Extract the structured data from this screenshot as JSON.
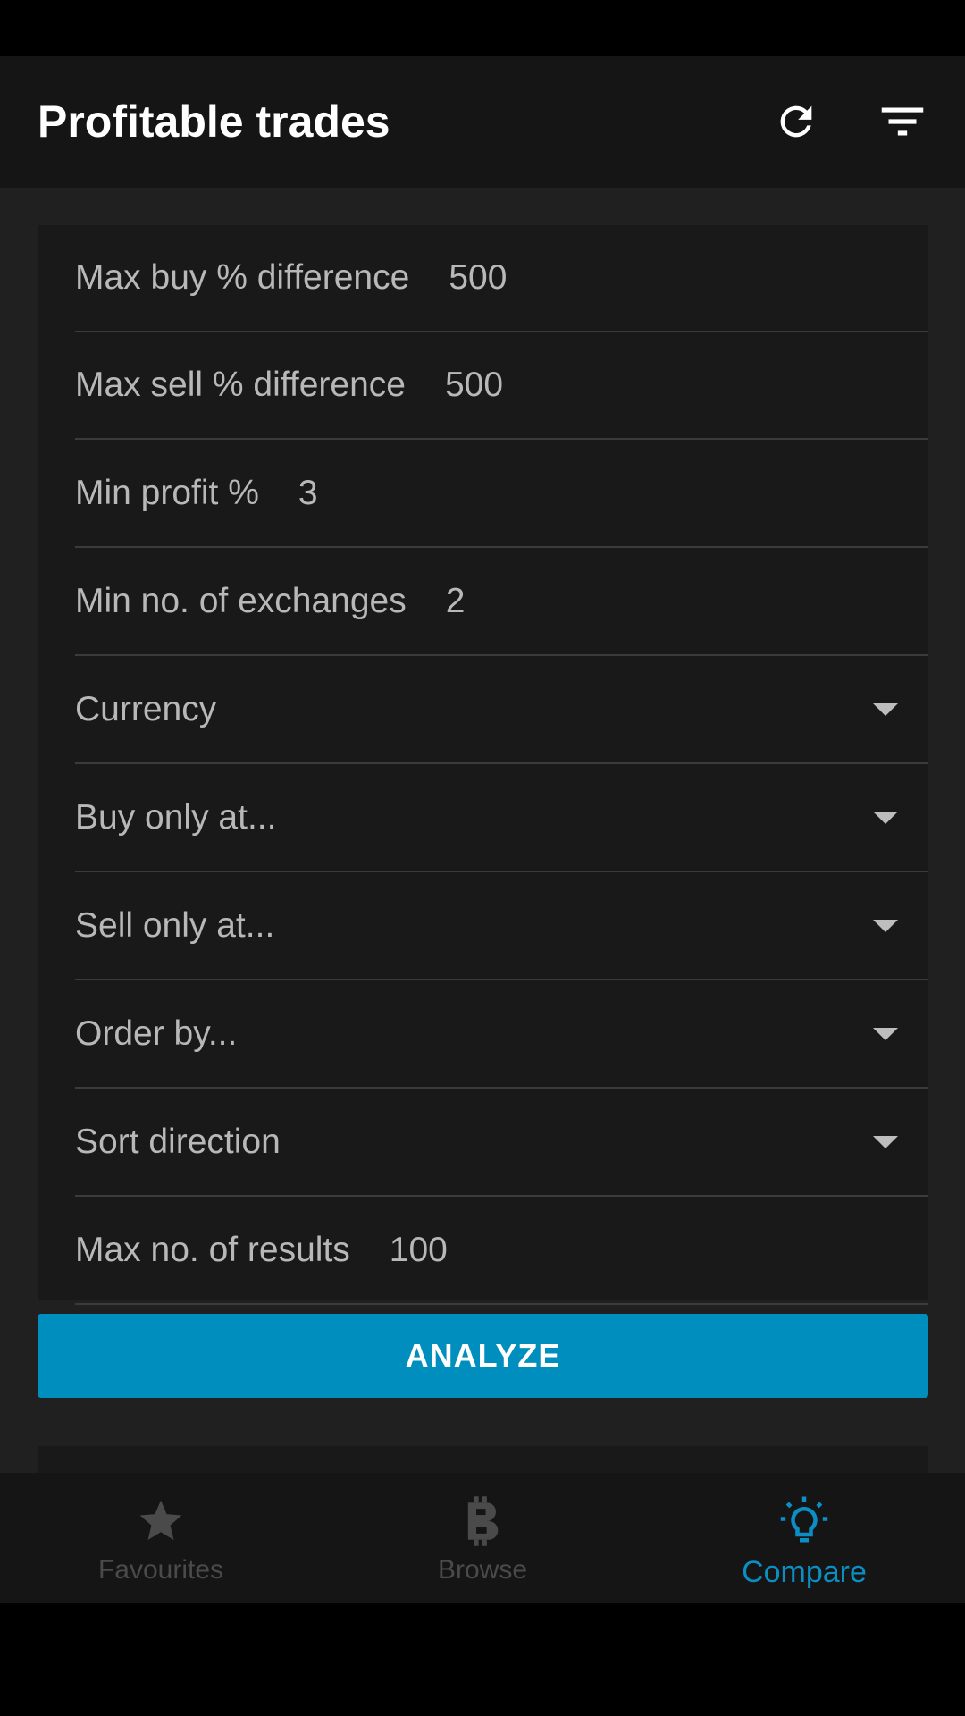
{
  "app": {
    "title": "Profitable trades",
    "actions": {
      "refresh_icon": "refresh-icon",
      "filter_icon": "filter-list-icon"
    }
  },
  "form": {
    "rows": [
      {
        "label": "Max buy % difference",
        "value": "500"
      },
      {
        "label": "Max sell % difference",
        "value": "500"
      },
      {
        "label": "Min profit %",
        "value": "3"
      },
      {
        "label": "Min no. of exchanges",
        "value": "2"
      },
      {
        "label": "Currency",
        "value": ""
      },
      {
        "label": "Buy only at...",
        "value": ""
      },
      {
        "label": "Sell only at...",
        "value": ""
      },
      {
        "label": "Order by...",
        "value": ""
      },
      {
        "label": "Sort direction",
        "value": ""
      },
      {
        "label": "Max no. of results",
        "value": "100"
      }
    ],
    "analyze_label": "ANALYZE"
  },
  "bottom_nav": {
    "items": [
      {
        "label": "Favourites",
        "icon": "star-icon",
        "active": false
      },
      {
        "label": "Browse",
        "icon": "bitcoin-icon",
        "active": false
      },
      {
        "label": "Compare",
        "icon": "lightbulb-icon",
        "active": true
      }
    ]
  },
  "colors": {
    "accent": "#008ebe",
    "active_nav": "#0a8ec3",
    "background": "#202020",
    "card": "#191919",
    "appbar": "#151515"
  }
}
